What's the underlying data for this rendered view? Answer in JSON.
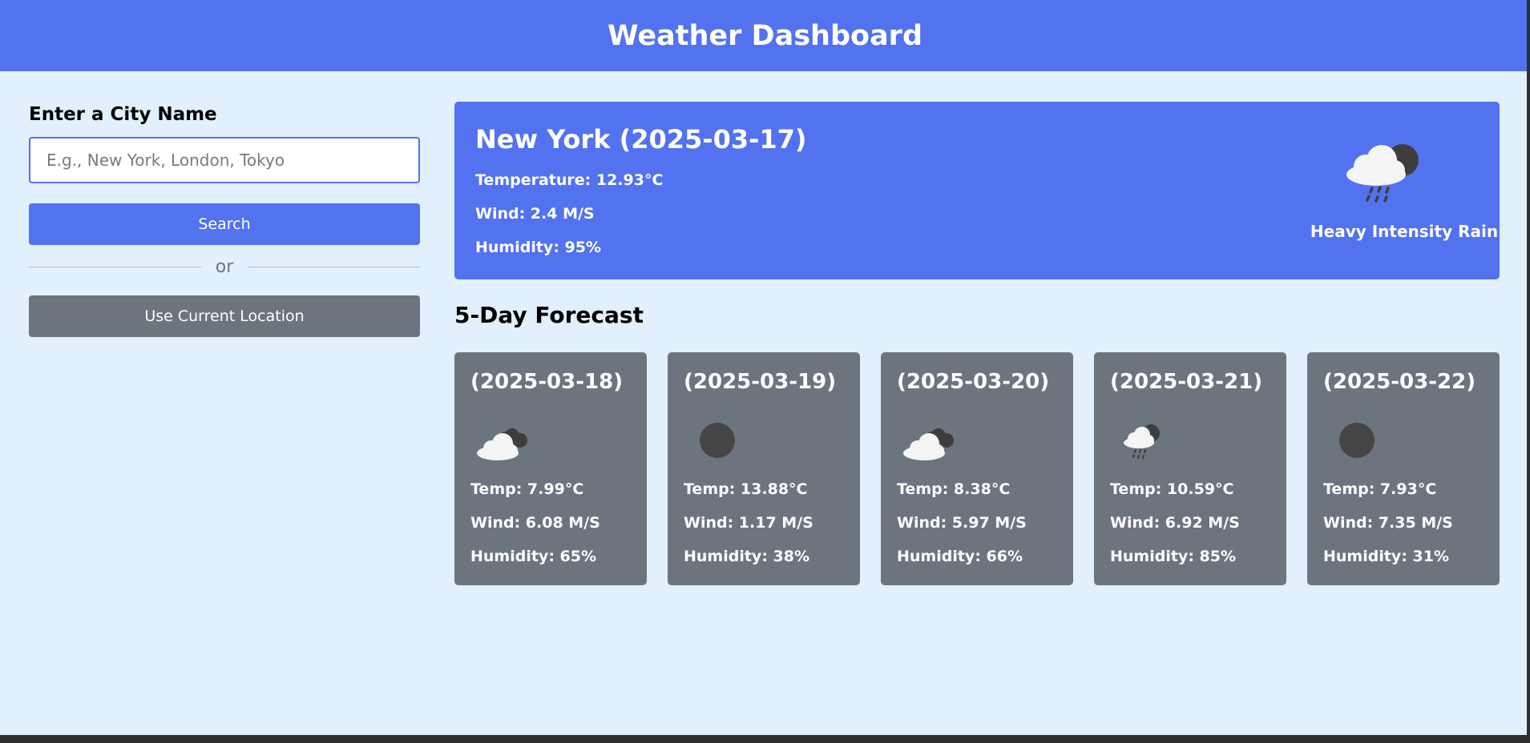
{
  "header": {
    "title": "Weather Dashboard"
  },
  "sidebar": {
    "city_label": "Enter a City Name",
    "input_placeholder": "E.g., New York, London, Tokyo",
    "search_label": "Search",
    "separator_text": "or",
    "location_label": "Use Current Location"
  },
  "current": {
    "title": "New York (2025-03-17)",
    "temperature": "Temperature: 12.93°C",
    "wind": "Wind: 2.4 M/S",
    "humidity": "Humidity: 95%",
    "icon": "rain-cloud-moon-icon",
    "condition": "Heavy Intensity Rain"
  },
  "forecast": {
    "title": "5-Day Forecast",
    "days": [
      {
        "date": "(2025-03-18)",
        "icon": "cloud-icon",
        "temp": "Temp: 7.99°C",
        "wind": "Wind: 6.08 M/S",
        "humidity": "Humidity: 65%"
      },
      {
        "date": "(2025-03-19)",
        "icon": "clear-icon",
        "temp": "Temp: 13.88°C",
        "wind": "Wind: 1.17 M/S",
        "humidity": "Humidity: 38%"
      },
      {
        "date": "(2025-03-20)",
        "icon": "cloud-icon",
        "temp": "Temp: 8.38°C",
        "wind": "Wind: 5.97 M/S",
        "humidity": "Humidity: 66%"
      },
      {
        "date": "(2025-03-21)",
        "icon": "rain-cloud-moon-icon",
        "temp": "Temp: 10.59°C",
        "wind": "Wind: 6.92 M/S",
        "humidity": "Humidity: 85%"
      },
      {
        "date": "(2025-03-22)",
        "icon": "clear-icon",
        "temp": "Temp: 7.93°C",
        "wind": "Wind: 7.35 M/S",
        "humidity": "Humidity: 31%"
      }
    ]
  },
  "colors": {
    "primary": "#5372f0",
    "secondary": "#6c757d",
    "background": "#e1f0fc"
  }
}
